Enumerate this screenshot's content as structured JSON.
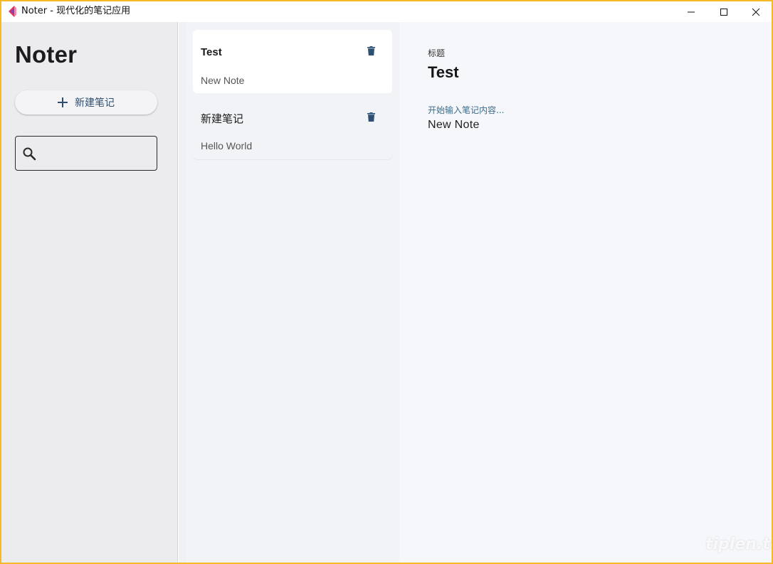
{
  "window": {
    "title": "Noter - 现代化的笔记应用",
    "controls": {
      "minimize": "minimize",
      "maximize": "maximize",
      "close": "close"
    }
  },
  "sidebar": {
    "brand": "Noter",
    "new_note_label": "新建笔记",
    "search": {
      "value": "",
      "placeholder": ""
    }
  },
  "notes": [
    {
      "title": "Test",
      "preview": "New Note",
      "active": true
    },
    {
      "title": "新建笔记",
      "preview": "Hello World",
      "active": false
    }
  ],
  "editor": {
    "title_label": "标题",
    "title_value": "Test",
    "content_hint": "开始输入笔记内容...",
    "content_value": "New Note"
  },
  "watermark": "tiplen.top",
  "colors": {
    "accent": "#2d4f72",
    "window_border": "#f6b826",
    "app_icon_red": "#e2325f",
    "app_icon_purple": "#8d3bb8"
  }
}
